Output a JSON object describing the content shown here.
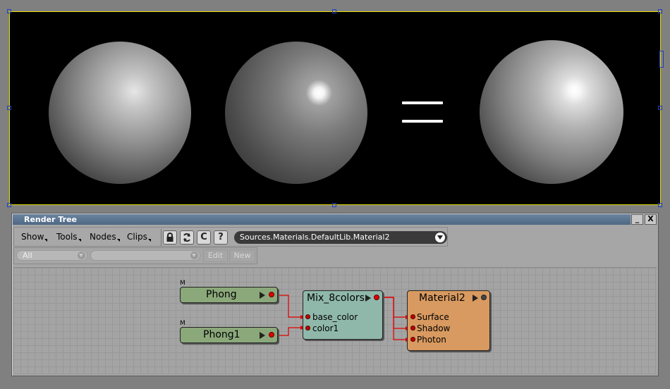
{
  "panel": {
    "title": "Render Tree",
    "minimize_label": "_",
    "close_label": "X"
  },
  "menus": {
    "show": "Show",
    "tools": "Tools",
    "nodes": "Nodes",
    "clips": "Clips"
  },
  "toolbar": {
    "lock_icon": "lock-icon",
    "refresh_icon": "refresh-icon",
    "c_label": "C",
    "help_label": "?",
    "path": "Sources.Materials.DefaultLib.Material2"
  },
  "filters": {
    "filter_value": "All",
    "edit_label": "Edit",
    "new_label": "New"
  },
  "nodes": {
    "phong": {
      "label": "Phong",
      "marker": "M"
    },
    "phong1": {
      "label": "Phong1",
      "marker": "M"
    },
    "mix": {
      "label": "Mix_8colors",
      "inputs": [
        "base_color",
        "color1"
      ]
    },
    "material": {
      "label": "Material2",
      "inputs": [
        "Surface",
        "Shadow",
        "Photon"
      ]
    }
  },
  "colors": {
    "phong_node": "#8ba87a",
    "mix_node": "#8fb8aa",
    "material_node": "#d89a60",
    "connection": "#e00000",
    "viewport_border": "#e8e000"
  }
}
